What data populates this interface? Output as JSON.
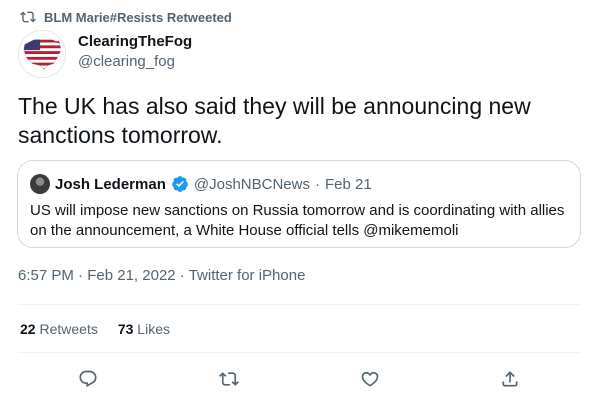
{
  "retweet": {
    "label": "BLM Marie#Resists Retweeted",
    "icon": "retweet-icon"
  },
  "author": {
    "display_name": "ClearingTheFog",
    "handle": "@clearing_fog",
    "avatar_icon": "us-flag-map-avatar"
  },
  "tweet": {
    "text": "The UK has also said they will be announcing new sanctions tomorrow."
  },
  "quote": {
    "author_name": "Josh Lederman",
    "verified_icon": "verified-badge-icon",
    "handle": "@JoshNBCNews",
    "separator": "·",
    "date": "Feb 21",
    "text": "US will impose new sanctions on Russia tomorrow and is coordinating with allies on the announcement, a White House official tells @mikememoli"
  },
  "meta": {
    "time": "6:57 PM",
    "separator": "·",
    "date": "Feb 21, 2022",
    "source": "Twitter for iPhone"
  },
  "stats": {
    "retweets_count": "22",
    "retweets_label": "Retweets",
    "likes_count": "73",
    "likes_label": "Likes"
  },
  "actions": {
    "reply_icon": "reply-icon",
    "retweet_icon": "retweet-icon",
    "like_icon": "heart-icon",
    "share_icon": "share-icon"
  },
  "colors": {
    "secondary_text": "#536471",
    "primary_text": "#0f1419",
    "verified_blue": "#1d9bf0",
    "border": "#cfd9de"
  }
}
